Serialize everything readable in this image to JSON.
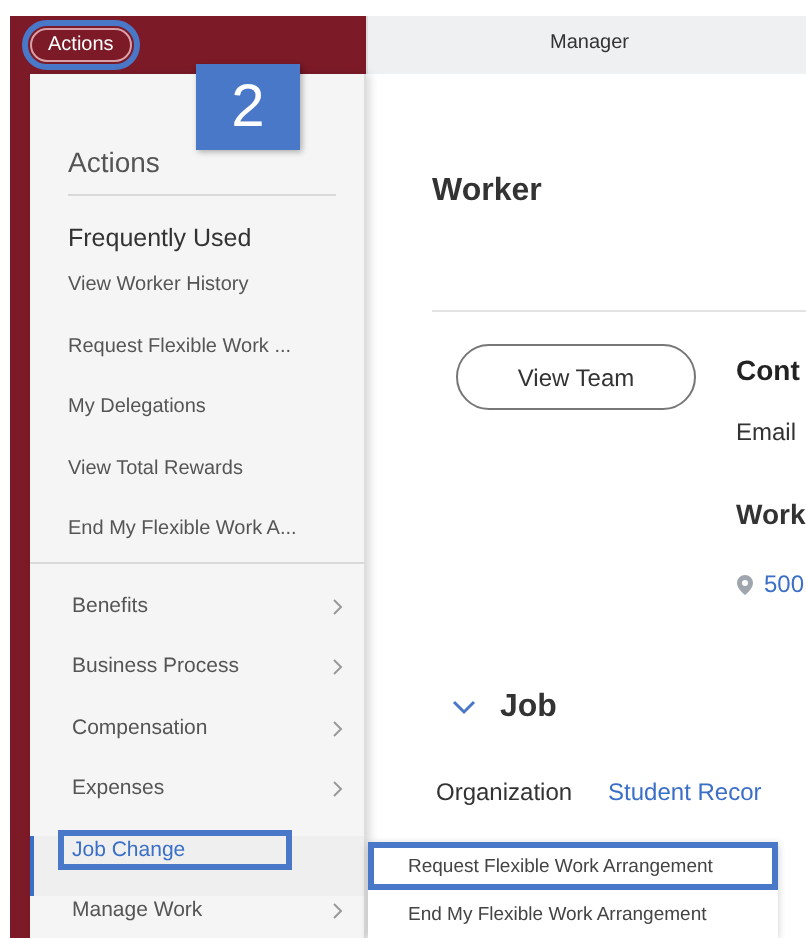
{
  "header": {
    "actions_button": {
      "label": "Actions",
      "highlighted": true
    },
    "manager_label": "Manager"
  },
  "step_badge": "2",
  "menu": {
    "title": "Actions",
    "frequent_heading": "Frequently Used",
    "frequent_items": [
      "View Worker History",
      "Request Flexible Work ...",
      "My Delegations",
      "View Total Rewards",
      "End My Flexible Work A..."
    ],
    "categories": [
      {
        "label": "Benefits",
        "selected": false,
        "highlighted": false,
        "has_submenu": true
      },
      {
        "label": "Business Process",
        "selected": false,
        "highlighted": false,
        "has_submenu": true
      },
      {
        "label": "Compensation",
        "selected": false,
        "highlighted": false,
        "has_submenu": true
      },
      {
        "label": "Expenses",
        "selected": false,
        "highlighted": false,
        "has_submenu": true
      },
      {
        "label": "Job Change",
        "selected": true,
        "highlighted": true,
        "has_submenu": false
      },
      {
        "label": "Manage Work",
        "selected": false,
        "highlighted": false,
        "has_submenu": true
      }
    ]
  },
  "worker": {
    "title": "Worker",
    "view_team_button": "View Team",
    "contact_heading": "Cont",
    "email_label": "Email",
    "work_heading": "Work",
    "address_link": "500"
  },
  "job": {
    "heading": "Job",
    "expanded": true,
    "organization_label": "Organization",
    "organization_value": "Student Recor"
  },
  "submenu": {
    "items": [
      {
        "label": "Request Flexible Work Arrangement",
        "highlighted": true
      },
      {
        "label": "End My Flexible Work Arrangement",
        "highlighted": false
      }
    ]
  }
}
